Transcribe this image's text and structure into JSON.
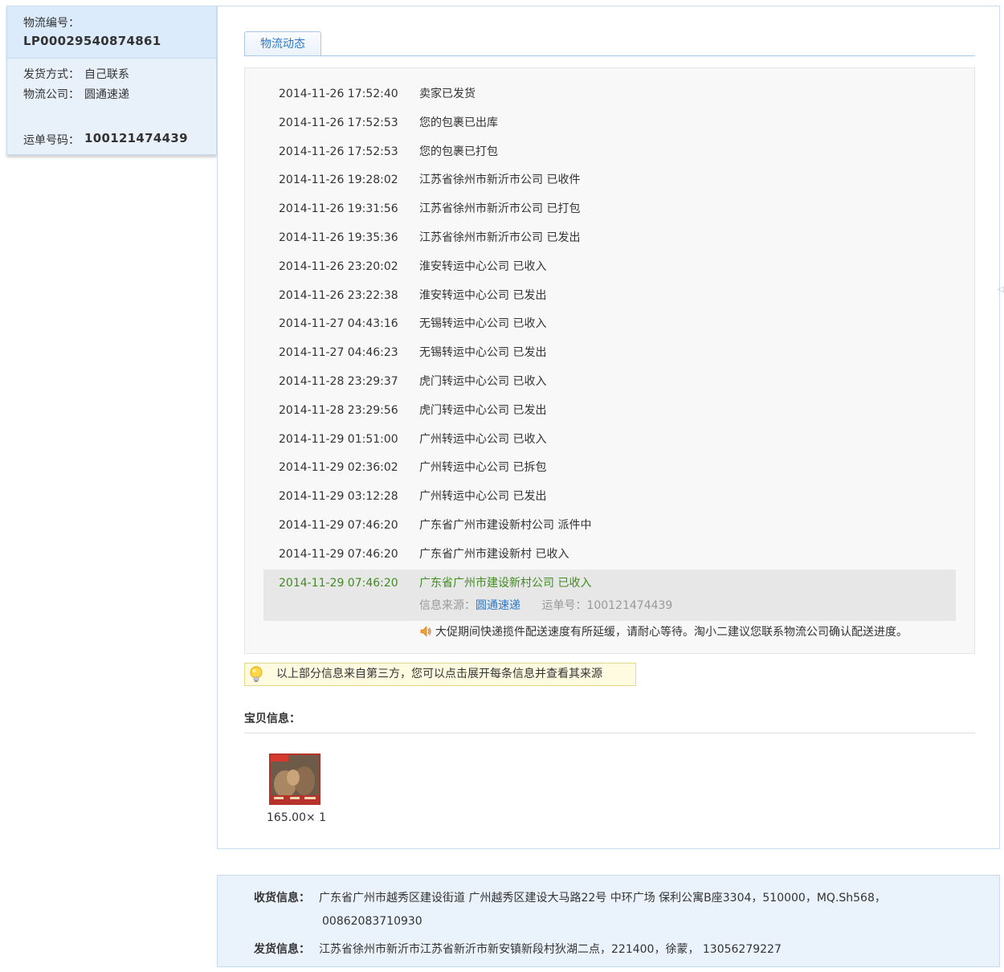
{
  "order_card": {
    "logistics_no_label": "物流编号：",
    "logistics_no": "LP00029540874861",
    "ship_method_label": "发货方式：",
    "ship_method": "自己联系",
    "company_label": "物流公司：",
    "company": "圆通速递",
    "waybill_label": "运单号码：",
    "waybill": "100121474439"
  },
  "tabs": {
    "active": "物流动态"
  },
  "tracking": {
    "events": [
      {
        "time": "2014-11-26 17:52:40",
        "desc": "卖家已发货"
      },
      {
        "time": "2014-11-26 17:52:53",
        "desc": "您的包裹已出库"
      },
      {
        "time": "2014-11-26 17:52:53",
        "desc": "您的包裹已打包"
      },
      {
        "time": "2014-11-26 19:28:02",
        "desc": "江苏省徐州市新沂市公司 已收件"
      },
      {
        "time": "2014-11-26 19:31:56",
        "desc": "江苏省徐州市新沂市公司 已打包"
      },
      {
        "time": "2014-11-26 19:35:36",
        "desc": "江苏省徐州市新沂市公司 已发出"
      },
      {
        "time": "2014-11-26 23:20:02",
        "desc": "淮安转运中心公司 已收入"
      },
      {
        "time": "2014-11-26 23:22:38",
        "desc": "淮安转运中心公司 已发出"
      },
      {
        "time": "2014-11-27 04:43:16",
        "desc": "无锡转运中心公司 已收入"
      },
      {
        "time": "2014-11-27 04:46:23",
        "desc": "无锡转运中心公司 已发出"
      },
      {
        "time": "2014-11-28 23:29:37",
        "desc": "虎门转运中心公司 已收入"
      },
      {
        "time": "2014-11-28 23:29:56",
        "desc": "虎门转运中心公司 已发出"
      },
      {
        "time": "2014-11-29 01:51:00",
        "desc": "广州转运中心公司 已收入"
      },
      {
        "time": "2014-11-29 02:36:02",
        "desc": "广州转运中心公司 已拆包"
      },
      {
        "time": "2014-11-29 03:12:28",
        "desc": "广州转运中心公司 已发出"
      },
      {
        "time": "2014-11-29 07:46:20",
        "desc": "广东省广州市建设新村公司 派件中"
      },
      {
        "time": "2014-11-29 07:46:20",
        "desc": "广东省广州市建设新村 已收入"
      }
    ],
    "latest": {
      "time": "2014-11-29 07:46:20",
      "desc": "广东省广州市建设新村公司 已收入",
      "source_label": "信息来源：",
      "source_link": "圆通速递",
      "waybill_label": "运单号：",
      "waybill": "100121474439"
    },
    "notice": "大促期间快递揽件配送速度有所延缓，请耐心等待。淘小二建议您联系物流公司确认配送进度。"
  },
  "tip": "以上部分信息来自第三方，您可以点击展开每条信息并查看其来源",
  "product_section": {
    "title": "宝贝信息：",
    "price_qty": "165.00× 1"
  },
  "address": {
    "receive_label": "收货信息：",
    "receive_line1": "广东省广州市越秀区建设街道 广州越秀区建设大马路22号 中环广场 保利公寓B座3304，510000，MQ.Sh568，",
    "receive_line2": "00862083710930",
    "send_label": "发货信息：",
    "send_value": "江苏省徐州市新沂市江苏省新沂市新安镇新段村狄湖二点，221400，徐蒙，   13056279227"
  },
  "colors": {
    "accent_blue": "#2d78c8",
    "latest_green": "#3f8d1f",
    "panel_blue": "#e8f1fa"
  }
}
